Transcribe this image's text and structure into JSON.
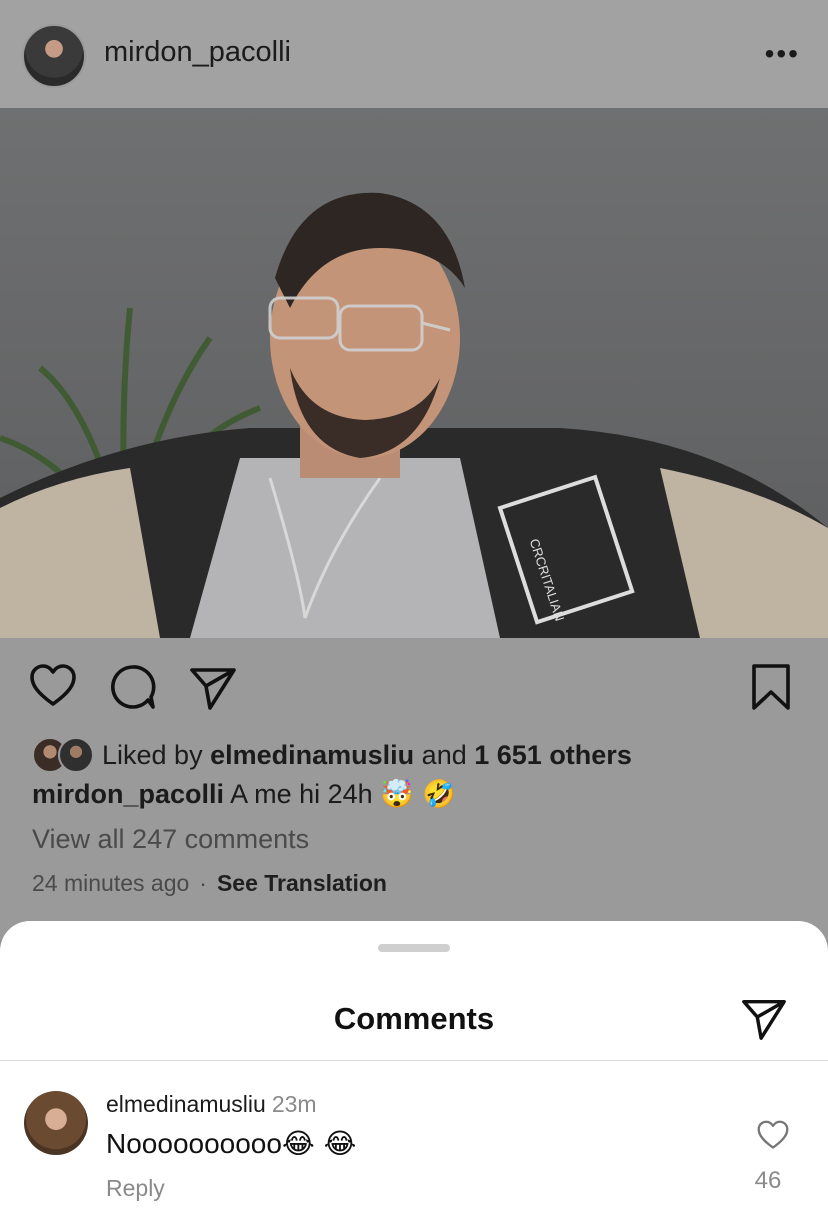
{
  "post": {
    "username": "mirdon_pacolli",
    "more_label": "•••",
    "liked_prefix": "Liked by",
    "liked_user": "elmedinamusliu",
    "liked_and": "and",
    "liked_others": "1 651 others",
    "caption_user": "mirdon_pacolli",
    "caption_text": "A me hi 24h",
    "caption_emojis": "🤯 🤣",
    "view_all": "View all 247 comments",
    "time_ago": "24 minutes ago",
    "separator": "·",
    "see_translation": "See Translation",
    "jacket_text": "CRCRITALIAN"
  },
  "sheet": {
    "title": "Comments"
  },
  "comment": {
    "user": "elmedinamusliu",
    "time": "23m",
    "text": "Noooooooooo",
    "emojis": "😂 😂",
    "reply_label": "Reply",
    "like_count": "46"
  }
}
